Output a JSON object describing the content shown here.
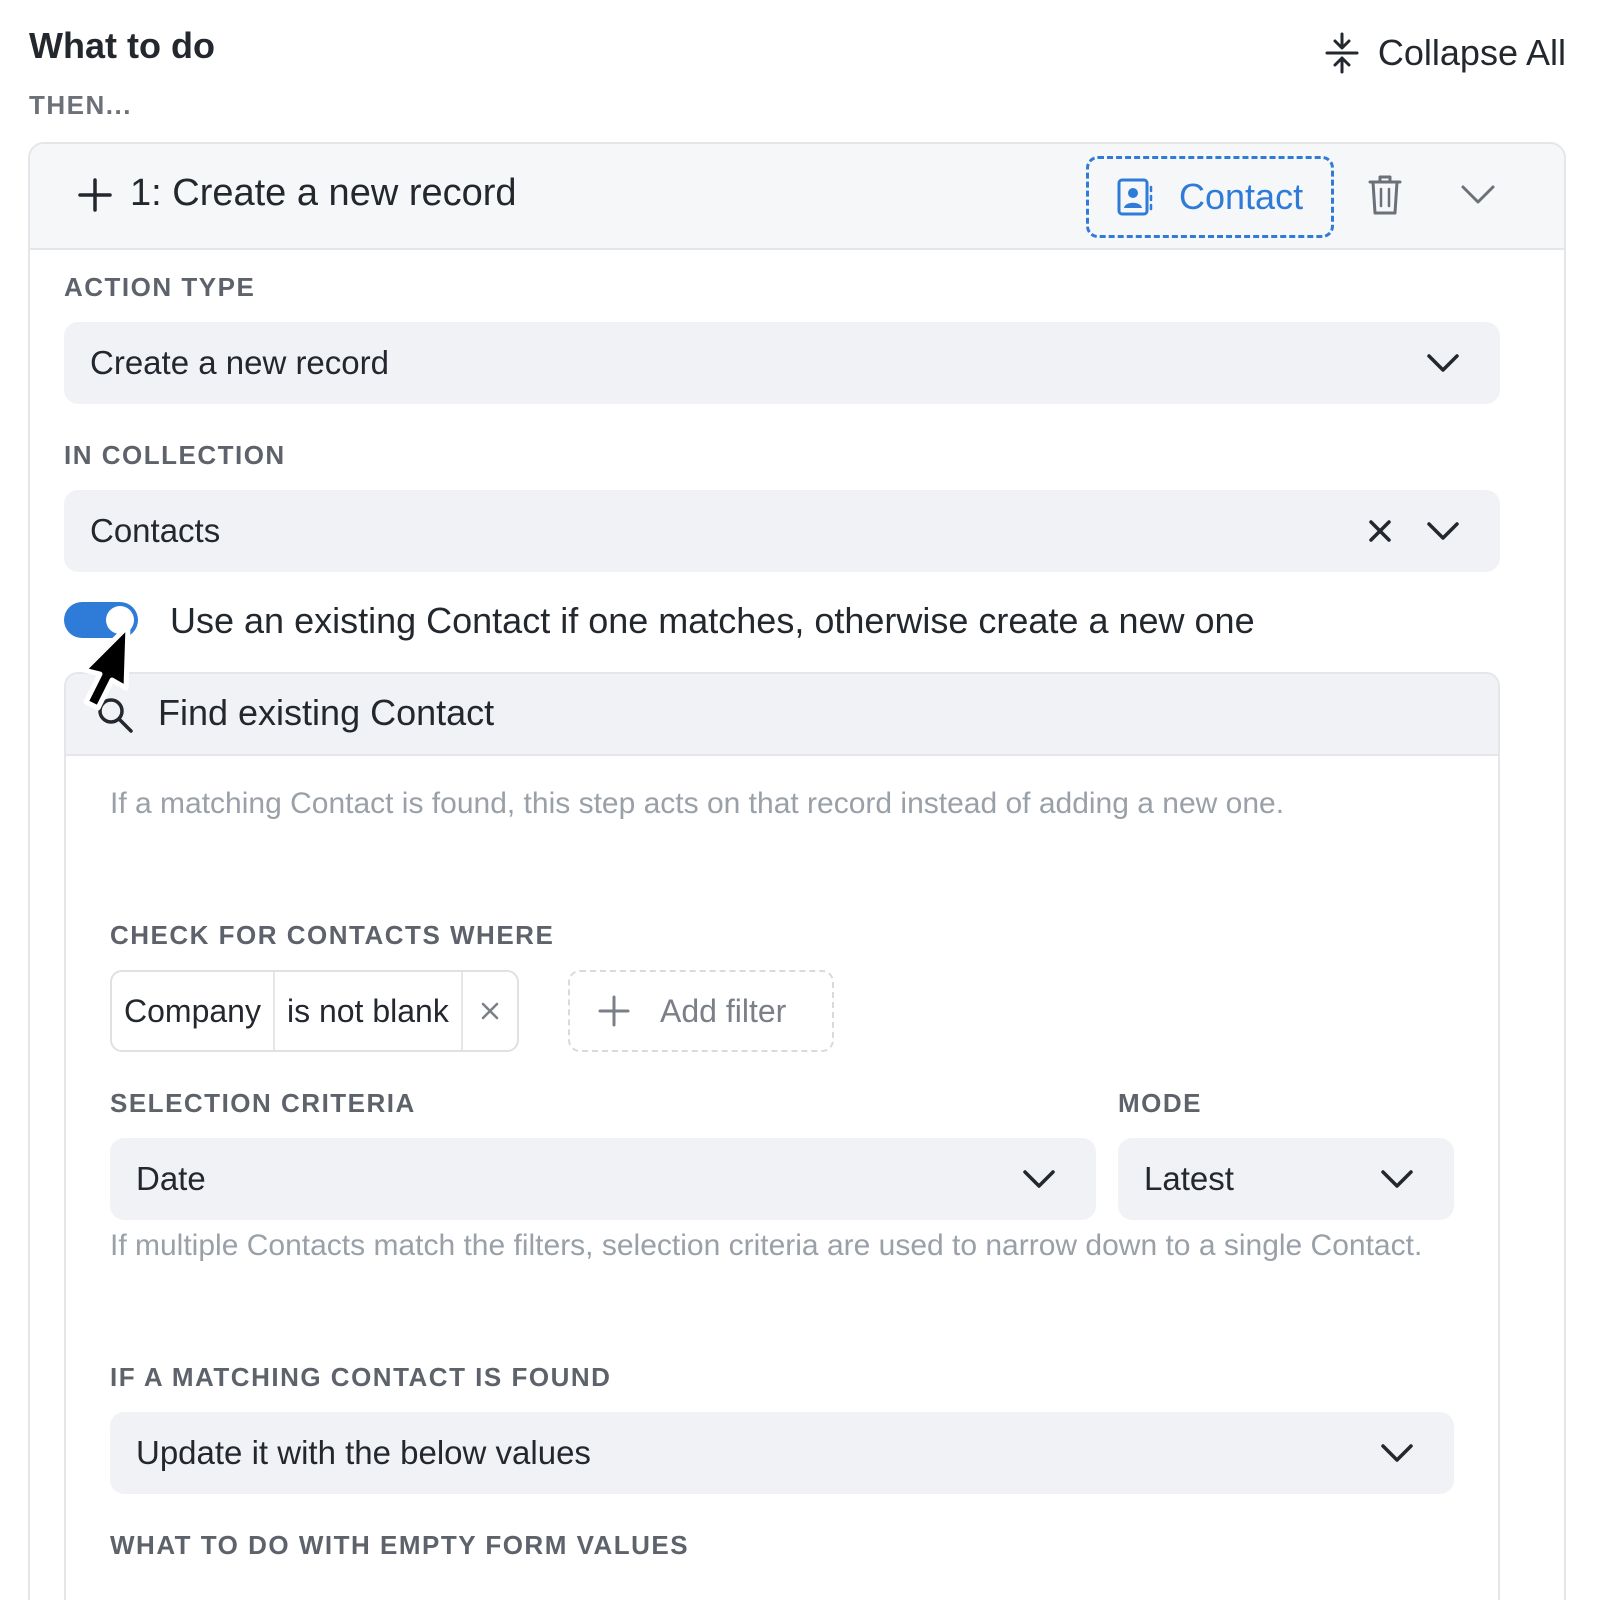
{
  "header": {
    "title": "What to do",
    "subtitle": "THEN...",
    "collapse_all_label": "Collapse All"
  },
  "step": {
    "title": "1: Create a new record",
    "object_chip_label": "Contact"
  },
  "action_type": {
    "label": "ACTION TYPE",
    "value": "Create a new record"
  },
  "collection": {
    "label": "IN COLLECTION",
    "value": "Contacts"
  },
  "toggle": {
    "enabled": true,
    "label": "Use an existing Contact if one matches, otherwise create a new one"
  },
  "find_existing": {
    "title": "Find existing Contact",
    "description": "If a matching Contact is found, this step acts on that record instead of adding a new one.",
    "check_label": "CHECK FOR CONTACTS WHERE",
    "filter": {
      "field": "Company",
      "operator": "is not blank"
    },
    "add_filter_label": "Add filter",
    "selection_criteria_label": "SELECTION CRITERIA",
    "selection_criteria_value": "Date",
    "mode_label": "MODE",
    "mode_value": "Latest",
    "selection_help": "If multiple Contacts match the filters, selection criteria are used to narrow down to a single Contact.",
    "matching_found_label": "IF A MATCHING CONTACT IS FOUND",
    "matching_found_value": "Update it with the below values",
    "empty_values_label": "WHAT TO DO WITH EMPTY FORM VALUES"
  },
  "colors": {
    "accent": "#2f7bd8",
    "field_bg": "#f1f2f5",
    "header_bg": "#f6f7f9",
    "border": "#e4e6ea",
    "muted_text": "#9aa0a8"
  }
}
